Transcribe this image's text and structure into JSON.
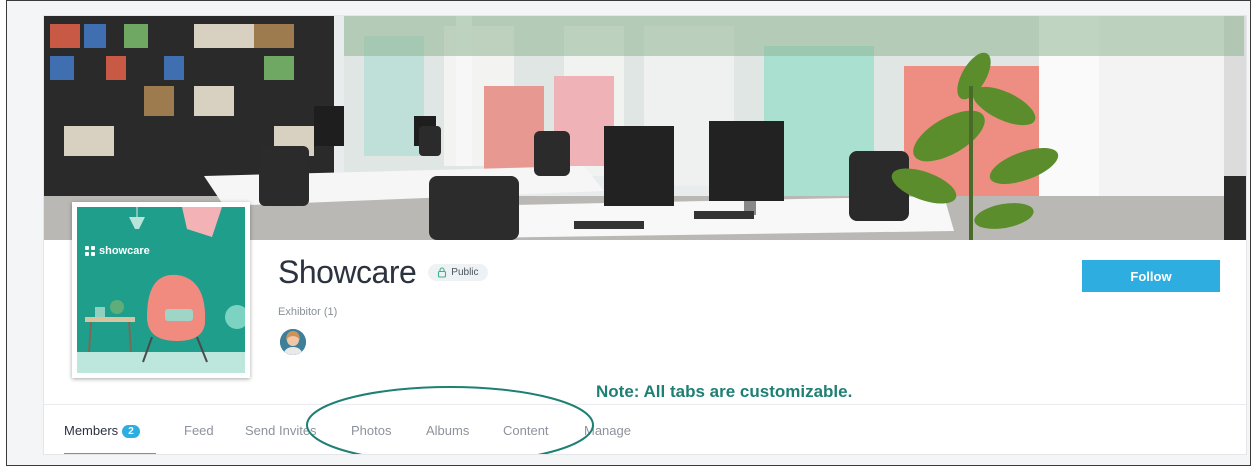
{
  "group": {
    "title": "Showcare",
    "visibility": "Public",
    "member_type": "Exhibitor (1)",
    "logo_text": "showcare"
  },
  "actions": {
    "follow_label": "Follow"
  },
  "annotation": {
    "note": "Note: All tabs are customizable."
  },
  "tabs": [
    {
      "label": "Members",
      "count": "2",
      "active": true
    },
    {
      "label": "Feed"
    },
    {
      "label": "Send Invites"
    },
    {
      "label": "Photos"
    },
    {
      "label": "Albums"
    },
    {
      "label": "Content"
    },
    {
      "label": "Manage"
    }
  ],
  "colors": {
    "accent": "#2eaee0",
    "brand_teal": "#1f9e8b",
    "note_text": "#1e7f73",
    "title_text": "#2b3240"
  },
  "icons": {
    "badge": "lock-icon",
    "logo": "showcare-logo-icon"
  }
}
